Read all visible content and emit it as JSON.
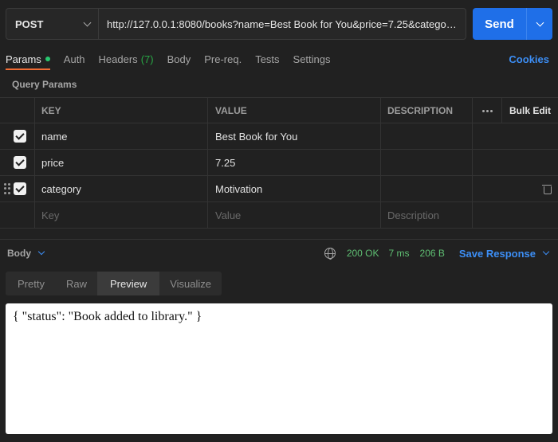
{
  "request": {
    "method": "POST",
    "url": "http://127.0.0.1:8080/books?name=Best Book for You&price=7.25&category=Motivation",
    "send_label": "Send"
  },
  "tabs": {
    "params": "Params",
    "auth": "Auth",
    "headers": "Headers",
    "headers_count": "(7)",
    "body": "Body",
    "prereq": "Pre-req.",
    "tests": "Tests",
    "settings": "Settings",
    "cookies": "Cookies"
  },
  "query_params": {
    "title": "Query Params",
    "columns": {
      "key": "KEY",
      "value": "VALUE",
      "description": "DESCRIPTION",
      "bulk_edit": "Bulk Edit"
    },
    "rows": [
      {
        "key": "name",
        "value": "Best Book for You",
        "description": ""
      },
      {
        "key": "price",
        "value": "7.25",
        "description": ""
      },
      {
        "key": "category",
        "value": "Motivation",
        "description": ""
      }
    ],
    "placeholders": {
      "key": "Key",
      "value": "Value",
      "description": "Description"
    }
  },
  "response": {
    "body_label": "Body",
    "status": "200 OK",
    "time": "7 ms",
    "size": "206 B",
    "save_label": "Save Response",
    "views": {
      "pretty": "Pretty",
      "raw": "Raw",
      "preview": "Preview",
      "visualize": "Visualize"
    },
    "active_view": "Preview",
    "preview_text": "{ \"status\": \"Book added to library.\" }"
  },
  "colors": {
    "accent": "#1f6fe8",
    "tab_underline": "#ef6c35",
    "status_ok": "#5fbf73",
    "link": "#3c8ef5"
  }
}
